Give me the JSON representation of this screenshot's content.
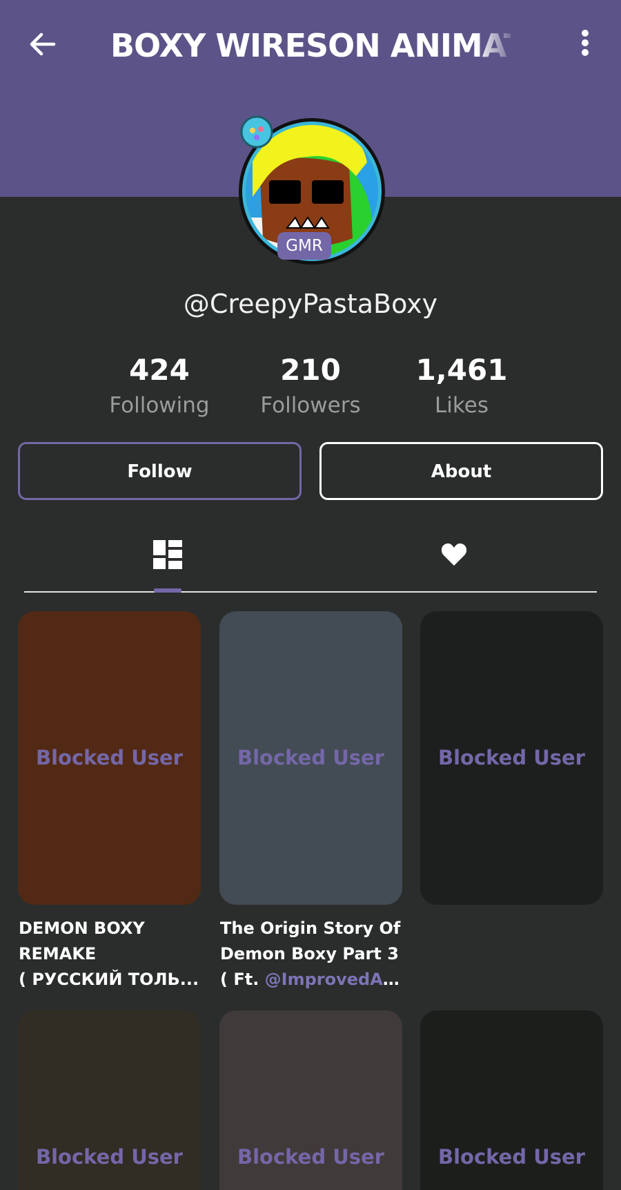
{
  "header": {
    "title": "BOXY WIRESON ANIMAT",
    "back_icon": "arrow-left-icon",
    "menu_icon": "more-vertical-icon",
    "bg_color": "#5c5488"
  },
  "profile": {
    "badge": "GMR",
    "username": "@CreepyPastaBoxy",
    "stats": [
      {
        "value": "424",
        "label": "Following"
      },
      {
        "value": "210",
        "label": "Followers"
      },
      {
        "value": "1,461",
        "label": "Likes"
      }
    ]
  },
  "actions": {
    "follow_label": "Follow",
    "about_label": "About"
  },
  "tabs": [
    {
      "icon": "grid-icon",
      "selected": true
    },
    {
      "icon": "heart-icon",
      "selected": false
    }
  ],
  "posts": [
    {
      "overlay": "Blocked User",
      "bg": "#522914",
      "caption_lines": [
        "DEMON BOXY",
        "REMAKE",
        "( РУССКИЙ ТОЛЬ..."
      ]
    },
    {
      "overlay": "Blocked User",
      "bg": "#434c54",
      "caption_lines": [
        "The Origin Story Of",
        "Demon Boxy Part 3"
      ],
      "caption_prefix": "( Ft. ",
      "caption_mention": "@ImprovedAn..."
    },
    {
      "overlay": "Blocked User",
      "bg": "#1c1f1d",
      "caption_lines": []
    },
    {
      "overlay": "Blocked User",
      "bg": "#312c24",
      "caption_lines": []
    },
    {
      "overlay": "Blocked User",
      "bg": "#413a3a",
      "caption_lines": []
    },
    {
      "overlay": "Blocked User",
      "bg": "#1c1e1c",
      "caption_lines": []
    }
  ],
  "colors": {
    "accent": "#7467a8",
    "background": "#2a2d2c"
  }
}
